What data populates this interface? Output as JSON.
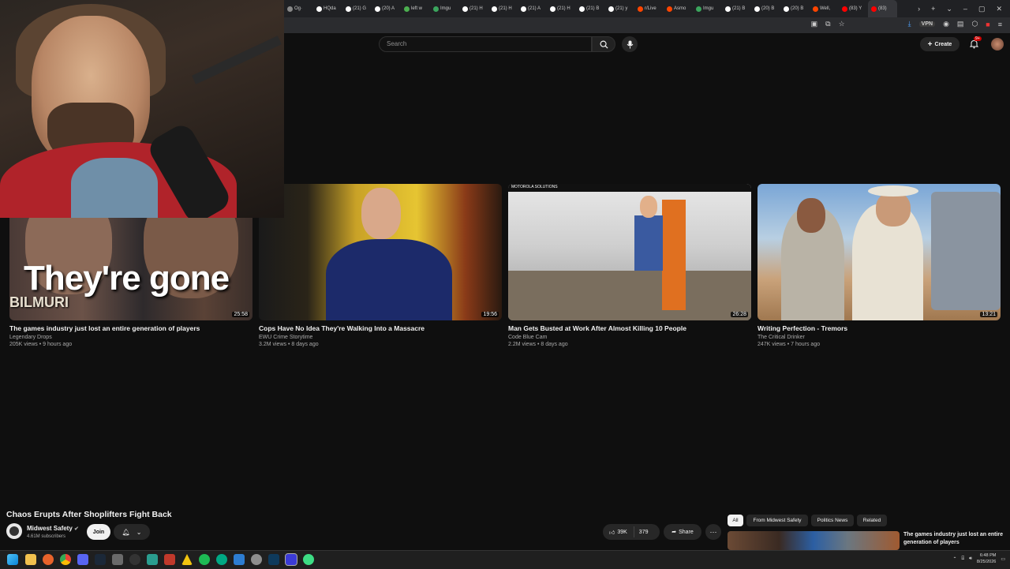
{
  "browser": {
    "tabs": [
      {
        "label": "Og·",
        "color": "#888"
      },
      {
        "label": "HQda",
        "color": "#fff"
      },
      {
        "label": "(21) G",
        "color": "#fff"
      },
      {
        "label": "(20) A",
        "color": "#fff"
      },
      {
        "label": "left w",
        "color": "#4caf50"
      },
      {
        "label": "Imgu",
        "color": "#3ba55d"
      },
      {
        "label": "(21) H",
        "color": "#fff"
      },
      {
        "label": "(21) H",
        "color": "#fff"
      },
      {
        "label": "(21) A",
        "color": "#fff"
      },
      {
        "label": "(21) H",
        "color": "#fff"
      },
      {
        "label": "(21) B",
        "color": "#fff"
      },
      {
        "label": "(21) y",
        "color": "#fff"
      },
      {
        "label": "r/Live",
        "color": "#ff4500"
      },
      {
        "label": "Asmo",
        "color": "#ff4500"
      },
      {
        "label": "Imgu",
        "color": "#3ba55d"
      },
      {
        "label": "(21) B",
        "color": "#fff"
      },
      {
        "label": "(20) B",
        "color": "#fff"
      },
      {
        "label": "(20) B",
        "color": "#fff"
      },
      {
        "label": "Well,",
        "color": "#ff4500"
      },
      {
        "label": "(83) Y",
        "color": "#ff0000"
      },
      {
        "label": "(83)",
        "color": "#ff0000",
        "active": true
      }
    ],
    "vpn_label": "VPN"
  },
  "youtube": {
    "search_placeholder": "Search",
    "create_label": "Create",
    "notif_badge": "9+",
    "videos": [
      {
        "title": "The games industry just lost an entire generation of players",
        "channel": "Legendary Drops",
        "meta": "205K views • 9 hours ago",
        "duration": "25:58",
        "thumb_text": "They're gone",
        "thumb_tag": "BILMURI"
      },
      {
        "title": "Cops Have No Idea They're Walking Into a Massacre",
        "channel": "EWU Crime Storytime",
        "meta": "3.2M views • 8 days ago",
        "duration": "19:56"
      },
      {
        "title": "Man Gets Busted at Work After Almost Killing 10 People",
        "channel": "Code Blue Cam",
        "meta": "2.2M views • 8 days ago",
        "duration": "26:28",
        "thumb_text": "MOTOROLA SOLUTIONS"
      },
      {
        "title": "Writing Perfection - Tremors",
        "channel": "The Critical Drinker",
        "meta": "247K views • 7 hours ago",
        "duration": "13:21"
      }
    ],
    "watch": {
      "title": "Chaos Erupts After Shoplifters Fight Back",
      "channel": "Midwest Safety",
      "subscribers": "4.61M subscribers",
      "join_label": "Join",
      "likes": "39K",
      "dislikes": "379",
      "share_label": "Share"
    },
    "chips": [
      "All",
      "From Midwest Safety",
      "Politics News",
      "Related"
    ],
    "next_title": "The games industry just lost an entire generation of players"
  },
  "taskbar": {
    "time": "6:48 PM",
    "date": "8/25/2026"
  }
}
